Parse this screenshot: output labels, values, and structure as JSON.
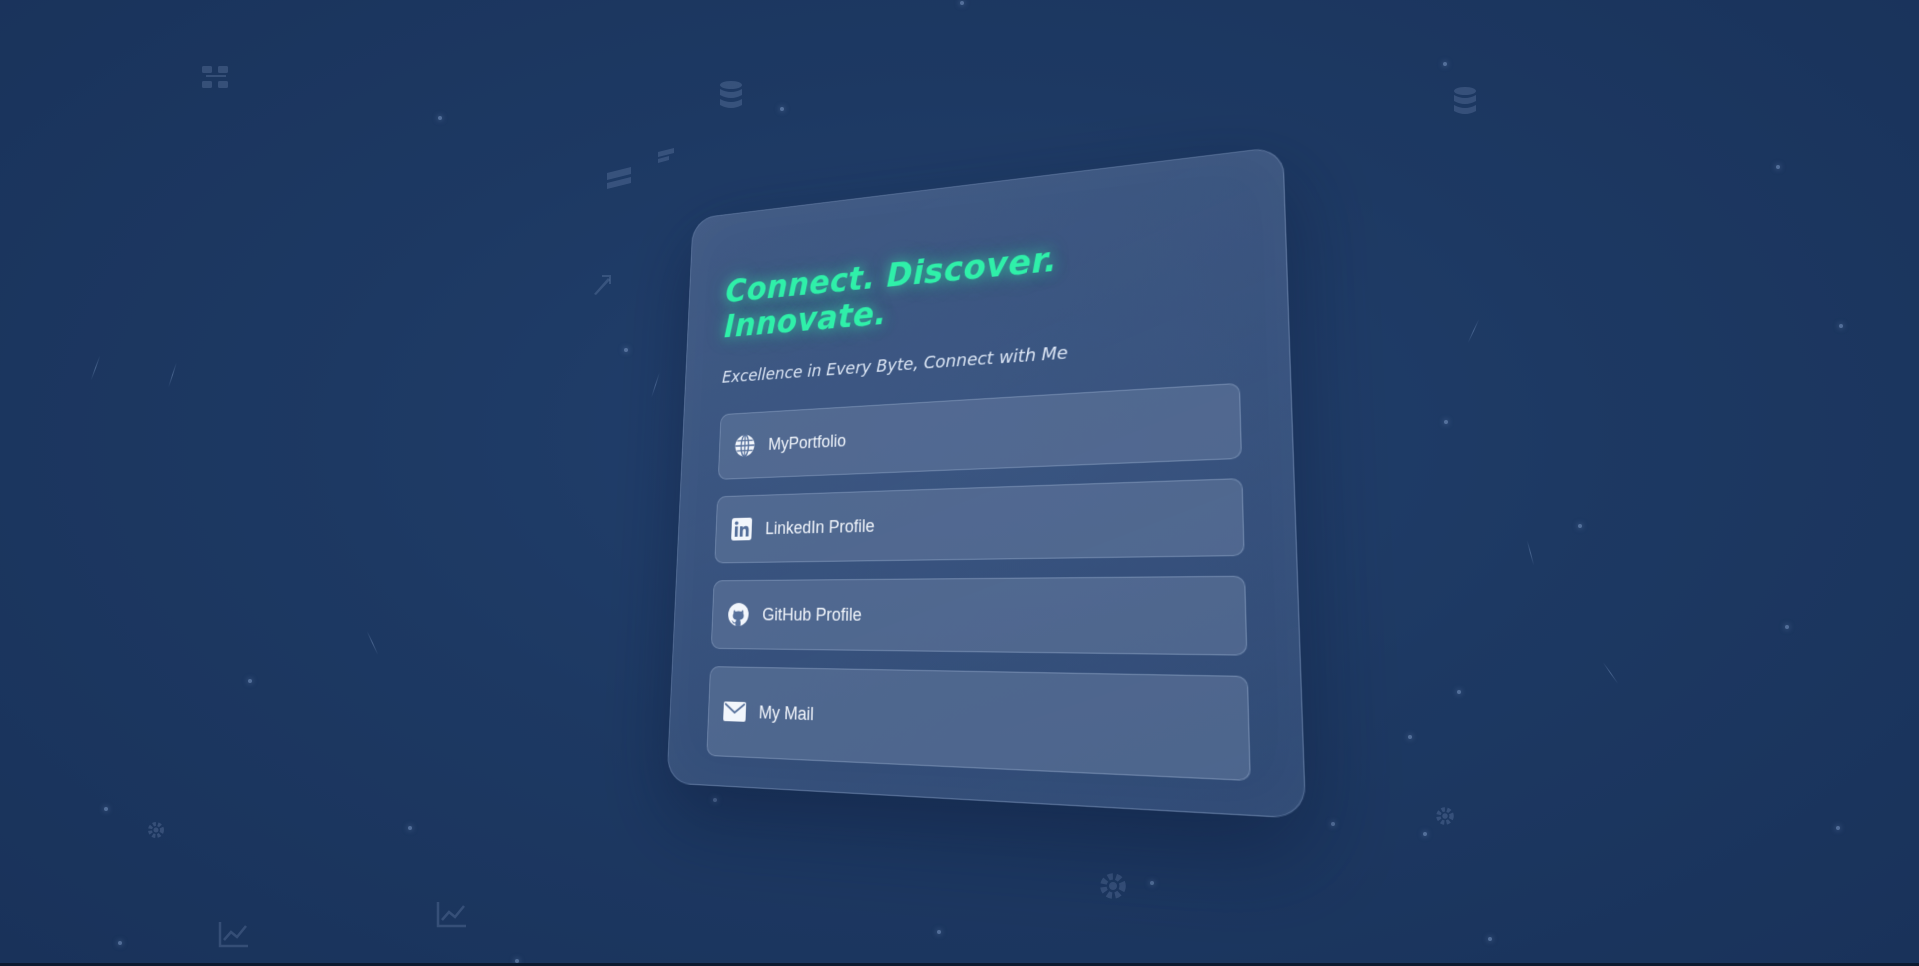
{
  "card": {
    "title": "Connect. Discover. Innovate.",
    "subtitle": "Excellence in Every Byte, Connect with Me"
  },
  "links": [
    {
      "label": "MyPortfolio",
      "icon": "globe-icon"
    },
    {
      "label": "LinkedIn Profile",
      "icon": "linkedin-icon"
    },
    {
      "label": "GitHub Profile",
      "icon": "github-icon"
    },
    {
      "label": "My Mail",
      "icon": "mail-icon"
    }
  ],
  "colors": {
    "accent": "#2ff0a9",
    "background": "#1d3963",
    "card": "#4a6491",
    "text": "#f2f6fc"
  },
  "background_icons": [
    "sitemap-icon",
    "database-icon",
    "database-icon",
    "layers-icon",
    "gear-icon",
    "gear-icon",
    "chart-line-icon",
    "chart-line-icon",
    "pen-icon"
  ]
}
